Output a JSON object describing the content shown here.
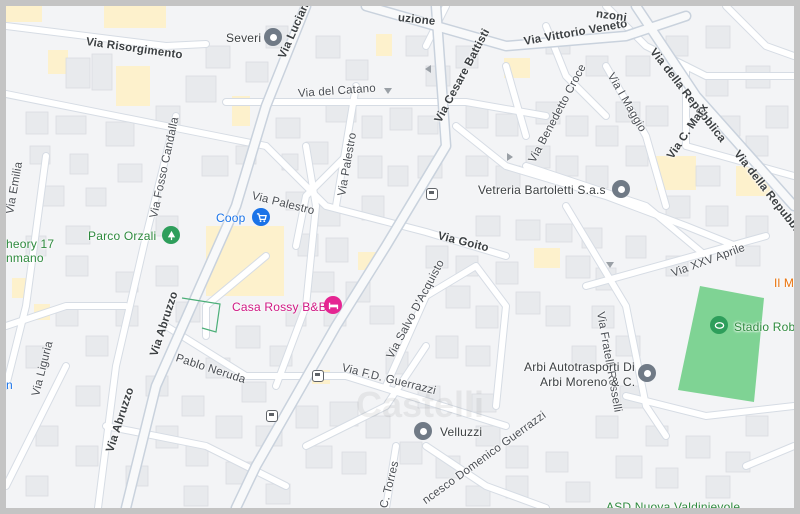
{
  "streets": {
    "via_risorgimento": "Via Risorgimento",
    "via_luciano_lama": "Via Luciano La",
    "via_del_catano": "Via del Catano",
    "via_cesare_battisti": "Via Cesare Battisti",
    "via_vittorio_veneto": "Via Vittorio Veneto",
    "via_della_repubblica_1": "Via della Repubblica",
    "via_della_repubblica_2": "Via della Repubblica",
    "via_c_marx": "Via C. Marx",
    "via_benedetto_croce": "Via Benedetto Croce",
    "via_i_maggio": "Via I Maggio",
    "via_emilia": "Via Emilia",
    "via_fosso_candalla": "Via Fosso Candalla",
    "via_palestro_1": "Via Palestro",
    "via_palestro_2": "Via Palestro",
    "via_goito": "Via Goito",
    "via_xxv_aprile": "Via XXV Aprile",
    "via_fratelli_rosselli": "Via Fratelli Rosselli",
    "via_abruzzo_1": "Via Abruzzo",
    "via_abruzzo_2": "Via Abruzzo",
    "via_salvo_dacquisto": "Via Salvo D'Acquisto",
    "pablo_neruda": "Pablo Neruda",
    "via_fd_guerrazzi": "Via F.D. Guerrazzi",
    "via_liguria": "Via Liguria",
    "c_torres": "C. Torres",
    "domenico_guerrazzi": "ncesco Domenico Guerrazzi",
    "top_uzione": "uzione",
    "top_nzoni": "nzoni"
  },
  "places": {
    "severi": "Severi",
    "vetreria": "Vetreria Bartoletti S.a.s",
    "parco_orzali": "Parco Orzali",
    "coop": "Coop",
    "casa_rossy": "Casa Rossy B&B",
    "stadio": "Stadio Rob",
    "arbi_line1": "Arbi Autotrasporti Di",
    "arbi_line2": "Arbi Moreno & C.",
    "velluzzi": "Velluzzi",
    "theory_line1": "heory 17",
    "theory_line2": "nmano",
    "right_edge": "Il M",
    "bottom_right": "ASD Nuova Valdinievole",
    "left_n": "n"
  },
  "colors": {
    "map_bg": "#f3f4f6",
    "road": "#ffffff",
    "road_outline": "#d6dce4",
    "major_road": "#c9d2dd",
    "building": "#e8eaed",
    "building_edge": "#dadce0",
    "commercial": "#fdf1cc",
    "park": "#7fd394",
    "green_label": "#2e8a3e",
    "coop_blue": "#1a73e8",
    "hotel_pink": "#e52592"
  }
}
